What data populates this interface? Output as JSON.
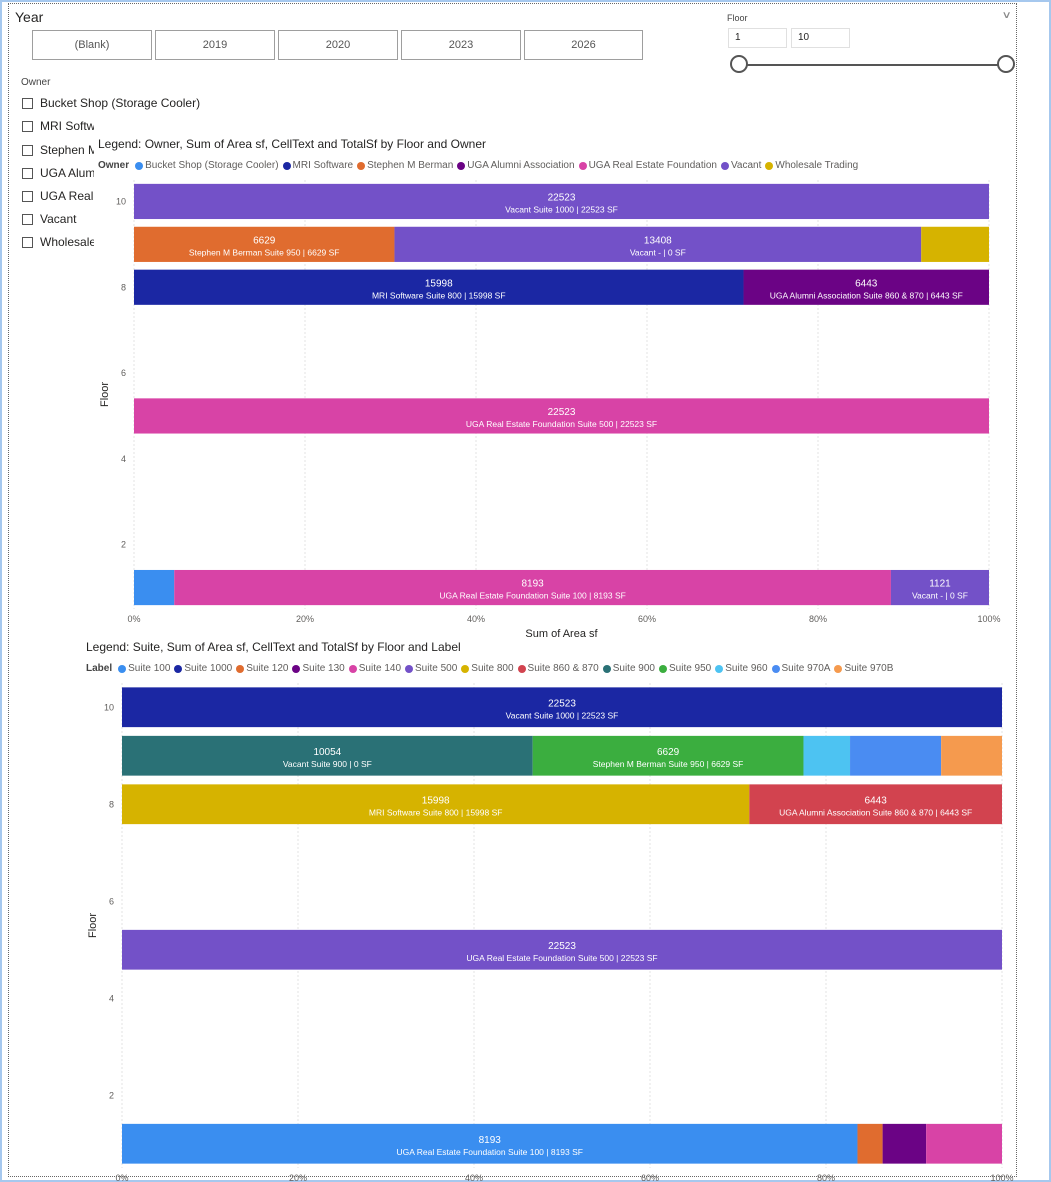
{
  "year_slicer": {
    "title": "Year",
    "options": [
      "(Blank)",
      "2019",
      "2020",
      "2023",
      "2026"
    ]
  },
  "floor_slicer": {
    "title": "Floor",
    "min_value": "1",
    "max_value": "10",
    "range": [
      1,
      10
    ]
  },
  "owner_slicer": {
    "title": "Owner",
    "items": [
      {
        "label": "Bucket Shop (Storage Cooler)"
      },
      {
        "label": "MRI Software"
      },
      {
        "label": "Stephen M Berman"
      },
      {
        "label": "UGA Alumni Association"
      },
      {
        "label": "UGA Real Estate Foundation"
      },
      {
        "label": "Vacant"
      },
      {
        "label": "Wholesale Trading"
      }
    ]
  },
  "chart1": {
    "title": "Legend: Owner, Sum of Area sf, CellText and TotalSf by Floor and Owner",
    "legend_title": "Owner",
    "legend": [
      {
        "name": "Bucket Shop (Storage Cooler)",
        "color": "#3a8ef0"
      },
      {
        "name": "MRI Software",
        "color": "#1b27a3"
      },
      {
        "name": "Stephen M Berman",
        "color": "#e06c2f"
      },
      {
        "name": "UGA Alumni Association",
        "color": "#6b0385"
      },
      {
        "name": "UGA Real Estate Foundation",
        "color": "#d843a6"
      },
      {
        "name": "Vacant",
        "color": "#7351c8"
      },
      {
        "name": "Wholesale Trading",
        "color": "#d6b300"
      }
    ]
  },
  "chart2": {
    "title": "Legend: Suite, Sum of Area sf, CellText and TotalSf by Floor and Label",
    "legend_title": "Label",
    "legend": [
      {
        "name": "Suite 100",
        "color": "#3a8ef0"
      },
      {
        "name": "Suite 1000",
        "color": "#1b27a3"
      },
      {
        "name": "Suite 120",
        "color": "#e06c2f"
      },
      {
        "name": "Suite 130",
        "color": "#6b0385"
      },
      {
        "name": "Suite 140",
        "color": "#d843a6"
      },
      {
        "name": "Suite 500",
        "color": "#7351c8"
      },
      {
        "name": "Suite 800",
        "color": "#d6b300"
      },
      {
        "name": "Suite 860 & 870",
        "color": "#d2434f"
      },
      {
        "name": "Suite 900",
        "color": "#2a7176"
      },
      {
        "name": "Suite 950",
        "color": "#3bae3f"
      },
      {
        "name": "Suite 960",
        "color": "#4dc3f2"
      },
      {
        "name": "Suite 970A",
        "color": "#4a8cf2"
      },
      {
        "name": "Suite 970B",
        "color": "#f59a4e"
      }
    ]
  },
  "chart_data": [
    {
      "type": "bar",
      "orientation": "horizontal",
      "stacking": "100% stacked",
      "title": "Legend: Owner, Sum of Area sf, CellText and TotalSf by Floor and Owner",
      "xlabel": "Sum of Area sf",
      "ylabel": "Floor",
      "xlim": [
        0,
        100
      ],
      "x_ticks": [
        "0%",
        "20%",
        "40%",
        "60%",
        "80%",
        "100%"
      ],
      "ylim": [
        0.5,
        10.5
      ],
      "y_ticks": [
        "2",
        "4",
        "6",
        "8",
        "10"
      ],
      "grid": true,
      "legend_position": "top",
      "rows": [
        {
          "floor": 10,
          "segments": [
            {
              "series": "Vacant",
              "value": 22523,
              "label": "22523",
              "sublabel": "Vacant Suite 1000 | 22523 SF",
              "color": "#7351c8"
            }
          ]
        },
        {
          "floor": 9,
          "segments": [
            {
              "series": "Stephen M Berman",
              "value": 6629,
              "label": "6629",
              "sublabel": "Stephen M Berman Suite 950 | 6629 SF",
              "color": "#e06c2f"
            },
            {
              "series": "Vacant",
              "value": 13408,
              "label": "13408",
              "sublabel": "Vacant - | 0 SF",
              "color": "#7351c8"
            },
            {
              "series": "Wholesale Trading",
              "value": 1725,
              "label": "",
              "sublabel": "",
              "color": "#d6b300"
            }
          ]
        },
        {
          "floor": 8,
          "segments": [
            {
              "series": "MRI Software",
              "value": 15998,
              "label": "15998",
              "sublabel": "MRI Software Suite 800 | 15998 SF",
              "color": "#1b27a3"
            },
            {
              "series": "UGA Alumni Association",
              "value": 6443,
              "label": "6443",
              "sublabel": "UGA Alumni Association Suite 860 & 870 | 6443 SF",
              "color": "#6b0385"
            }
          ]
        },
        {
          "floor": 5,
          "segments": [
            {
              "series": "UGA Real Estate Foundation",
              "value": 22523,
              "label": "22523",
              "sublabel": "UGA Real Estate Foundation Suite 500 | 22523 SF",
              "color": "#d843a6"
            }
          ]
        },
        {
          "floor": 1,
          "segments": [
            {
              "series": "Bucket Shop (Storage Cooler)",
              "value": 460,
              "label": "",
              "sublabel": "",
              "color": "#3a8ef0"
            },
            {
              "series": "UGA Real Estate Foundation",
              "value": 8193,
              "label": "8193",
              "sublabel": "UGA Real Estate Foundation Suite 100 | 8193 SF",
              "color": "#d843a6"
            },
            {
              "series": "Vacant",
              "value": 1121,
              "label": "1121",
              "sublabel": "Vacant - | 0 SF",
              "color": "#7351c8"
            }
          ]
        }
      ]
    },
    {
      "type": "bar",
      "orientation": "horizontal",
      "stacking": "100% stacked",
      "title": "Legend: Suite, Sum of Area sf, CellText and TotalSf by Floor and Label",
      "xlabel": "",
      "ylabel": "Floor",
      "xlim": [
        0,
        100
      ],
      "x_ticks": [
        "0%",
        "20%",
        "40%",
        "60%",
        "80%",
        "100%"
      ],
      "ylim": [
        0.5,
        10.5
      ],
      "y_ticks": [
        "2",
        "4",
        "6",
        "8",
        "10"
      ],
      "grid": true,
      "legend_position": "top",
      "rows": [
        {
          "floor": 10,
          "segments": [
            {
              "series": "Suite 1000",
              "value": 22523,
              "label": "22523",
              "sublabel": "Vacant Suite 1000 | 22523 SF",
              "color": "#1b27a3"
            }
          ]
        },
        {
          "floor": 9,
          "segments": [
            {
              "series": "Suite 900",
              "value": 10054,
              "label": "10054",
              "sublabel": "Vacant Suite 900 | 0 SF",
              "color": "#2a7176"
            },
            {
              "series": "Suite 950",
              "value": 6629,
              "label": "6629",
              "sublabel": "Stephen M Berman Suite 950 | 6629 SF",
              "color": "#3bae3f"
            },
            {
              "series": "Suite 960",
              "value": 1140,
              "label": "",
              "sublabel": "",
              "color": "#4dc3f2"
            },
            {
              "series": "Suite 970A",
              "value": 2230,
              "label": "",
              "sublabel": "",
              "color": "#4a8cf2"
            },
            {
              "series": "Suite 970B",
              "value": 1490,
              "label": "",
              "sublabel": "",
              "color": "#f59a4e"
            }
          ]
        },
        {
          "floor": 8,
          "segments": [
            {
              "series": "Suite 800",
              "value": 15998,
              "label": "15998",
              "sublabel": "MRI Software Suite 800 | 15998 SF",
              "color": "#d6b300"
            },
            {
              "series": "Suite 860 & 870",
              "value": 6443,
              "label": "6443",
              "sublabel": "UGA Alumni Association Suite 860 & 870 | 6443 SF",
              "color": "#d2434f"
            }
          ]
        },
        {
          "floor": 5,
          "segments": [
            {
              "series": "Suite 500",
              "value": 22523,
              "label": "22523",
              "sublabel": "UGA Real Estate Foundation Suite 500 | 22523 SF",
              "color": "#7351c8"
            }
          ]
        },
        {
          "floor": 1,
          "segments": [
            {
              "series": "Suite 100",
              "value": 8193,
              "label": "8193",
              "sublabel": "UGA Real Estate Foundation Suite 100 | 8193 SF",
              "color": "#3a8ef0"
            },
            {
              "series": "Suite 120",
              "value": 280,
              "label": "",
              "sublabel": "",
              "color": "#e06c2f"
            },
            {
              "series": "Suite 130",
              "value": 485,
              "label": "",
              "sublabel": "",
              "color": "#6b0385"
            },
            {
              "series": "Suite 140",
              "value": 845,
              "label": "",
              "sublabel": "",
              "color": "#d843a6"
            }
          ]
        }
      ]
    }
  ]
}
